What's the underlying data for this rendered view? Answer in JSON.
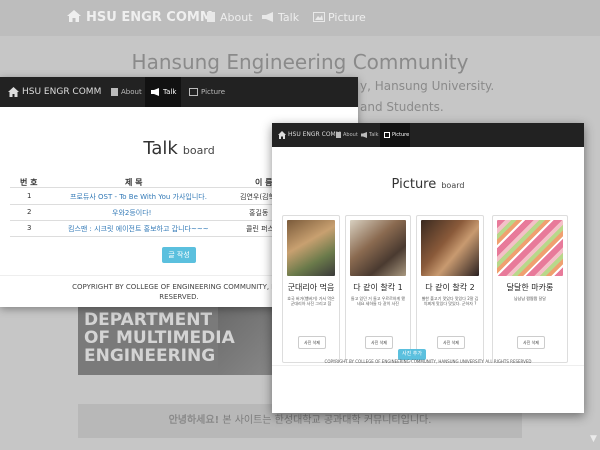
{
  "background": {
    "nav": {
      "brand": "HSU ENGR COMM",
      "about": "About",
      "talk": "Talk",
      "picture": "Picture"
    },
    "title": "Hansung Engineering Community",
    "subtitle_1": "y, Hansung University.",
    "subtitle_2": "and Students.",
    "banner_lines": [
      "DEPARTMENT",
      "OF MULTIMEDIA",
      "ENGINEERING"
    ],
    "footer_greeting": "안녕하세요!",
    "footer_text": " 본 사이트는 한성대학교 공과대학 커뮤니티입니다."
  },
  "talk_window": {
    "nav": {
      "brand": "HSU ENGR COMM",
      "about": "About",
      "talk": "Talk",
      "picture": "Picture"
    },
    "title": "Talk",
    "title_suffix": "board",
    "columns": [
      "번 호",
      "제 목",
      "이 름"
    ],
    "rows": [
      {
        "no": "1",
        "title": "프로듀사 OST - To Be With You 가사입니다.",
        "name": "김연우(김학"
      },
      {
        "no": "2",
        "title": "우와2등이다!",
        "name": "홍길동"
      },
      {
        "no": "3",
        "title": "킴스맨 : 시크릿 에이전트 홍보하고 갑니다~~~",
        "name": "콜린 퍼스"
      }
    ],
    "write_button": "글 작성",
    "copyright_1": "COPYRIGHT BY COLLEGE OF ENGINEERING COMMUNITY, HANSUNG UNIVERS",
    "copyright_2": "RESERVED."
  },
  "picture_window": {
    "nav": {
      "brand": "HSU ENGR COMM",
      "about": "About",
      "talk": "Talk",
      "picture": "Picture"
    },
    "title": "Picture",
    "title_suffix": "board",
    "cards": [
      {
        "title": "군대리아 먹음",
        "desc": "호국 버거(햄버거) 가서 먹은 군대리아 사진 그리고 참",
        "button": "사진 삭제"
      },
      {
        "title": "다 같이 찰칵 1",
        "desc": "들고 있던 거 들고 우르르하게 됐네요 세하들 다 같이 사진",
        "button": "사진 삭제"
      },
      {
        "title": "다 같이 찰칵 2",
        "desc": "별한 풀고기 맛있다 맛있다 2잘 김치찌개 맛있다 맛있다. 군하자 ?",
        "button": "사진 삭제"
      },
      {
        "title": "달달한 마카롱",
        "desc": "냠냠냠 짭짭짭 달달",
        "button": "사진 삭제"
      }
    ],
    "upload_button": "사진 추가",
    "copyright": "COPYRIGHT BY COLLEGE OF ENGINEERING COMMUNITY, HANSUNG UNIVERSITY. ALL RIGHTS RESERVED"
  }
}
